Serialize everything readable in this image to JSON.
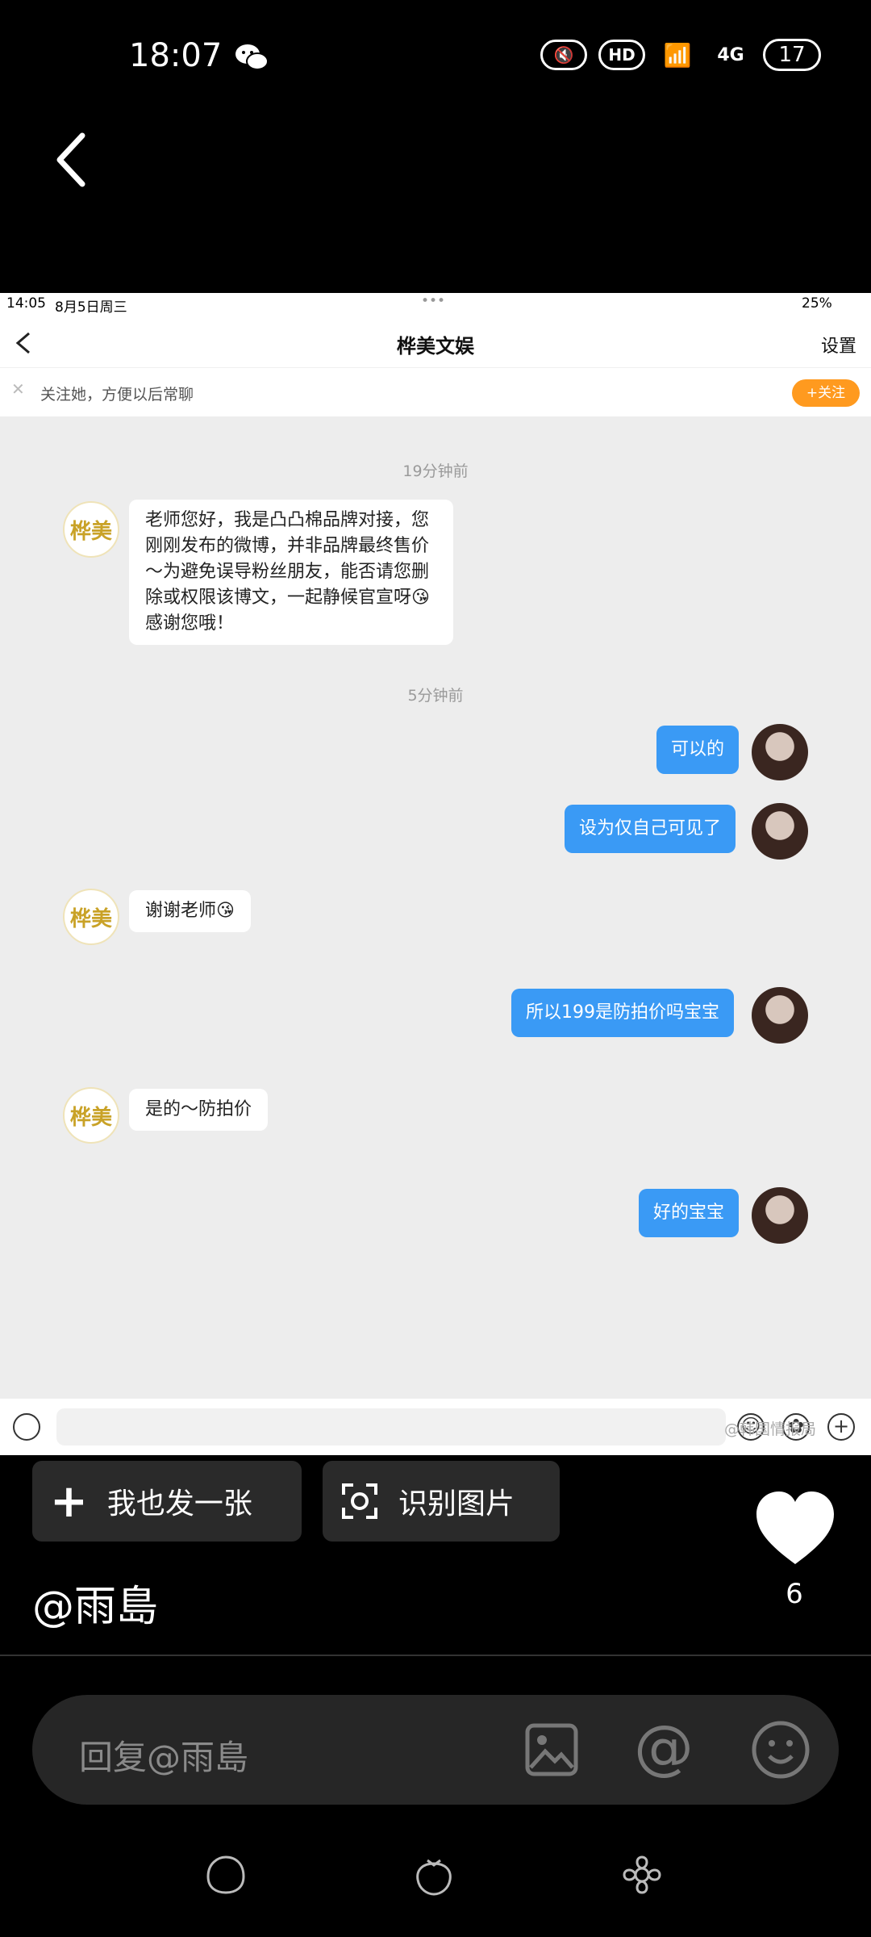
{
  "status_bar": {
    "time": "18:07",
    "signal": "4G",
    "hd": "HD",
    "battery": "17"
  },
  "screenshot": {
    "status": {
      "time": "14:05",
      "date": "8月5日周三",
      "battery": "25%"
    },
    "header": {
      "title": "桦美文娱",
      "settings": "设置"
    },
    "follow_bar": {
      "text": "关注她，方便以后常聊",
      "button": "+关注"
    },
    "brand_avatar_text": "桦美",
    "messages": [
      {
        "type": "timestamp",
        "text": "19分钟前"
      },
      {
        "type": "in",
        "text": "老师您好，我是凸凸棉品牌对接，您刚刚发布的微博，并非品牌最终售价～为避免误导粉丝朋友，能否请您删除或权限该博文，一起静候官宣呀😘感谢您哦！"
      },
      {
        "type": "timestamp",
        "text": "5分钟前"
      },
      {
        "type": "out",
        "text": "可以的"
      },
      {
        "type": "out",
        "text": "设为仅自己可见了"
      },
      {
        "type": "in",
        "text": "谢谢老师😘"
      },
      {
        "type": "out",
        "text": "所以199是防拍价吗宝宝"
      },
      {
        "type": "in",
        "text": "是的～防拍价"
      },
      {
        "type": "out",
        "text": "好的宝宝"
      }
    ],
    "watermark": "@韩国情报局"
  },
  "actions": {
    "post_same": "我也发一张",
    "recognize": "识别图片"
  },
  "like_count": "6",
  "author": "@雨島",
  "reply": {
    "placeholder": "回复@雨島"
  }
}
